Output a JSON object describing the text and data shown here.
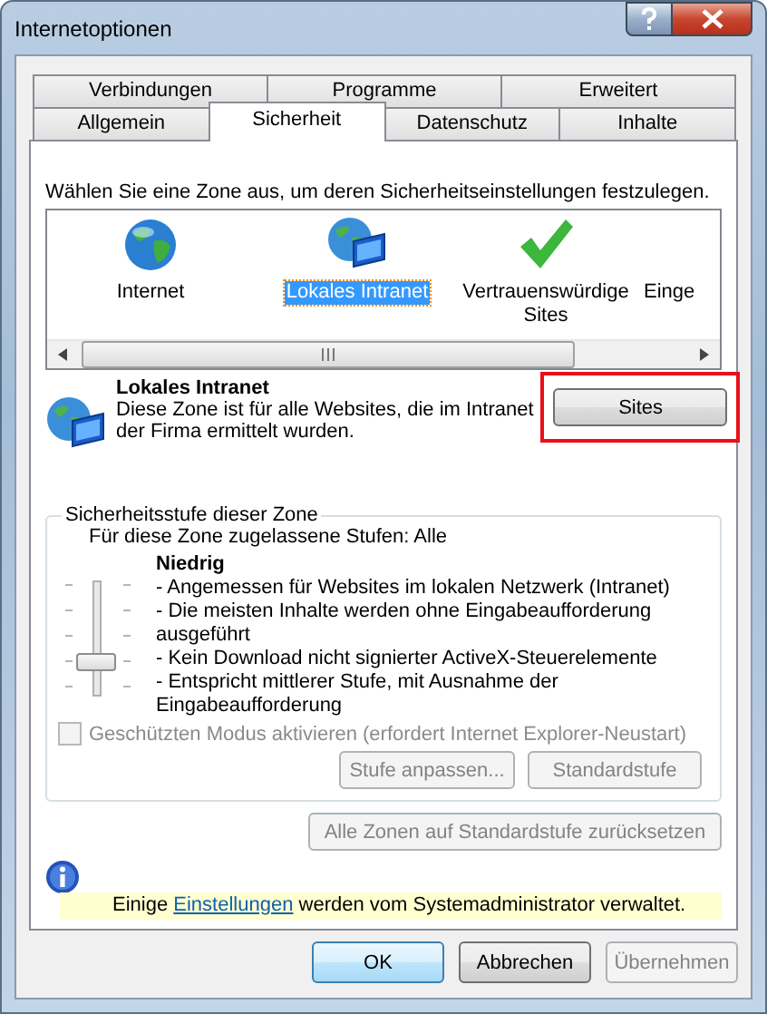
{
  "window": {
    "title": "Internetoptionen"
  },
  "tab_rows": [
    [
      {
        "label": "Verbindungen",
        "selected": false
      },
      {
        "label": "Programme",
        "selected": false
      },
      {
        "label": "Erweitert",
        "selected": false
      }
    ],
    [
      {
        "label": "Allgemein",
        "selected": false
      },
      {
        "label": "Sicherheit",
        "selected": true
      },
      {
        "label": "Datenschutz",
        "selected": false
      },
      {
        "label": "Inhalte",
        "selected": false
      }
    ]
  ],
  "instruction": "Wählen Sie eine Zone aus, um deren Sicherheitseinstellungen festzulegen.",
  "zones": [
    {
      "kind": "globe",
      "label": "Internet",
      "selected": false
    },
    {
      "kind": "intranet",
      "label": "Lokales Intranet",
      "selected": true
    },
    {
      "kind": "check",
      "label": "Vertrauenswürdige Sites",
      "selected": false
    },
    {
      "kind": "cut",
      "label": "Einge",
      "selected": false
    }
  ],
  "zone_info": {
    "title": "Lokales Intranet",
    "lines": [
      "Diese Zone ist für alle Websites, die im Intranet",
      "der Firma ermittelt wurden."
    ],
    "button": {
      "label": "Sites",
      "highlighted": true
    }
  },
  "security_level": {
    "legend": "Sicherheitsstufe dieser Zone",
    "allowed": "Für diese Zone zugelassene Stufen: Alle",
    "level_name": "Niedrig",
    "slider": {
      "level": 0.25
    },
    "bullets": [
      "- Angemessen für Websites im lokalen Netzwerk (Intranet)",
      "- Die meisten Inhalte werden ohne Eingabeaufforderung ausgeführt",
      "- Kein Download nicht signierter ActiveX-Steuerelemente",
      "- Entspricht mittlerer Stufe, mit Ausnahme der Eingabeaufforderung"
    ],
    "protected_mode": {
      "label": "Geschützten Modus aktivieren (erfordert Internet Explorer-Neustart)",
      "checked": false,
      "disabled": true
    },
    "buttons": [
      {
        "label": "Stufe anpassen...",
        "disabled": true
      },
      {
        "label": "Standardstufe",
        "disabled": true
      }
    ]
  },
  "reset_button": {
    "label": "Alle Zonen auf Standardstufe zurücksetzen",
    "disabled": true
  },
  "notice": {
    "before": "Einige ",
    "link": "Einstellungen",
    "after": " werden vom Systemadministrator verwaltet."
  },
  "footer_buttons": [
    {
      "label": "OK",
      "default": true,
      "disabled": false
    },
    {
      "label": "Abbrechen",
      "default": false,
      "disabled": false
    },
    {
      "label": "Übernehmen",
      "default": false,
      "disabled": true
    }
  ]
}
